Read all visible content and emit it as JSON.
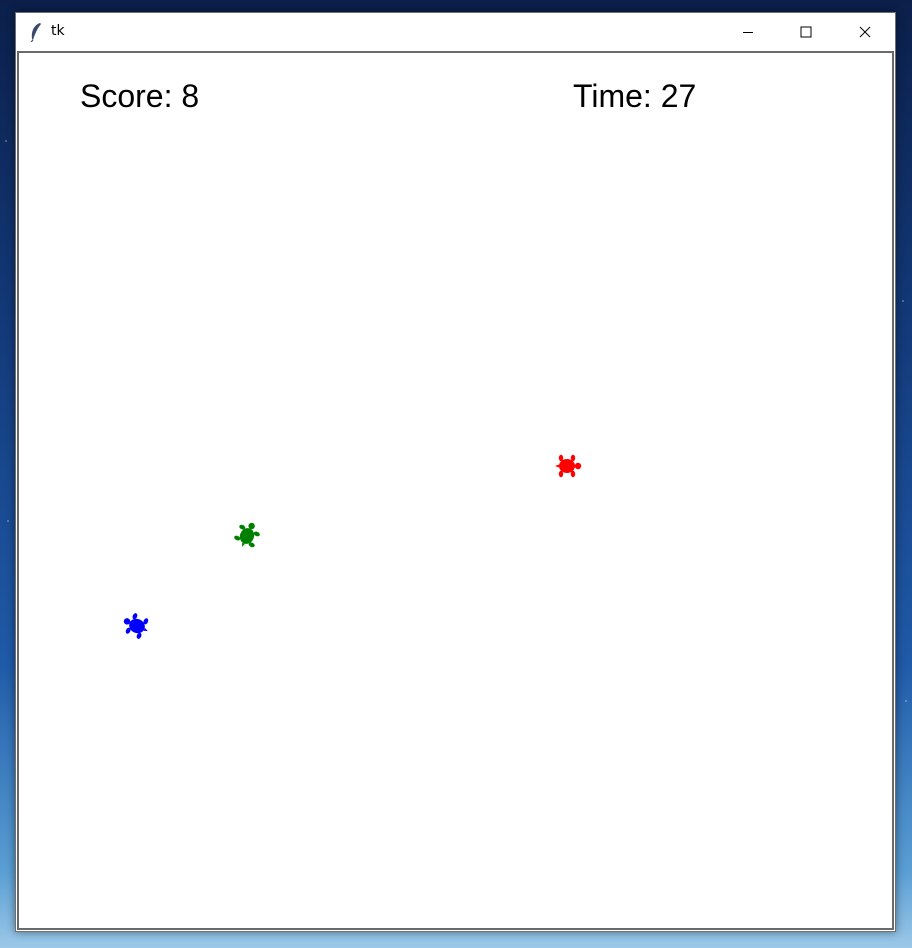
{
  "window": {
    "title": "tk",
    "controls": {
      "minimize_icon": "minimize-icon",
      "maximize_icon": "maximize-icon",
      "close_icon": "close-icon"
    }
  },
  "hud": {
    "score_text": "Score: 8",
    "time_text": "Time: 27"
  },
  "turtles": [
    {
      "name": "red-turtle",
      "color": "#ff0000",
      "heading_deg": 90
    },
    {
      "name": "green-turtle",
      "color": "#008000",
      "heading_deg": 25
    },
    {
      "name": "blue-turtle",
      "color": "#0000ff",
      "heading_deg": -65
    }
  ]
}
